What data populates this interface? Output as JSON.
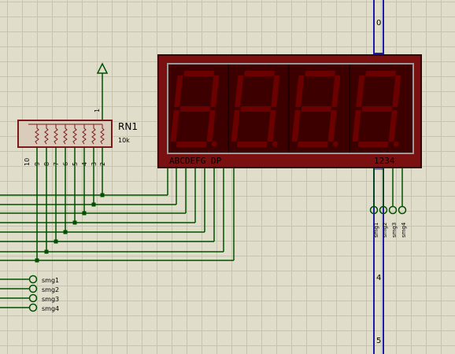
{
  "resistor_network": {
    "ref": "RN1",
    "value": "10k",
    "common_pin": "1",
    "pins": [
      "10",
      "9",
      "8",
      "7",
      "6",
      "5",
      "4",
      "3",
      "2"
    ]
  },
  "display": {
    "segment_label": "ABCDEFG DP",
    "digit_label": "1234",
    "digit_count": 4,
    "segment_color_off": "#6a0000",
    "body_color": "#7a1010",
    "window_color": "#3d0000"
  },
  "terminals_left": [
    "smg1",
    "smg2",
    "smg3",
    "smg4"
  ],
  "terminals_right": [
    "smg1",
    "smg2",
    "smg3",
    "smg4"
  ],
  "bus_markers": [
    "0",
    "4",
    "5"
  ],
  "colors": {
    "wire": "#005000",
    "component": "#7a1a1a",
    "bus": "#1c1ca8",
    "text": "#000000"
  }
}
